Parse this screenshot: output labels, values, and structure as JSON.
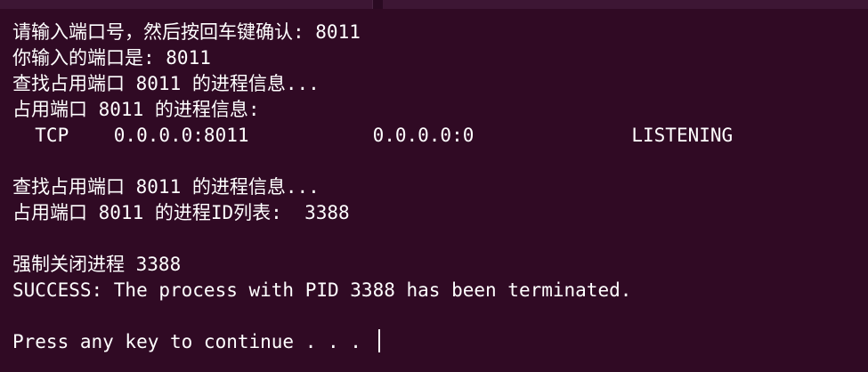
{
  "terminal": {
    "lines": [
      "请输入端口号，然后按回车键确认: 8011",
      "你输入的端口是: 8011",
      "查找占用端口 8011 的进程信息...",
      "占用端口 8011 的进程信息:",
      "  TCP    0.0.0.0:8011           0.0.0.0:0              LISTENING",
      "",
      "查找占用端口 8011 的进程信息...",
      "占用端口 8011 的进程ID列表:  3388",
      "",
      "强制关闭进程 3388",
      "SUCCESS: The process with PID 3388 has been terminated.",
      "",
      "Press any key to continue . . . "
    ]
  },
  "colors": {
    "background": "#300a24",
    "foreground": "#ffffff"
  }
}
